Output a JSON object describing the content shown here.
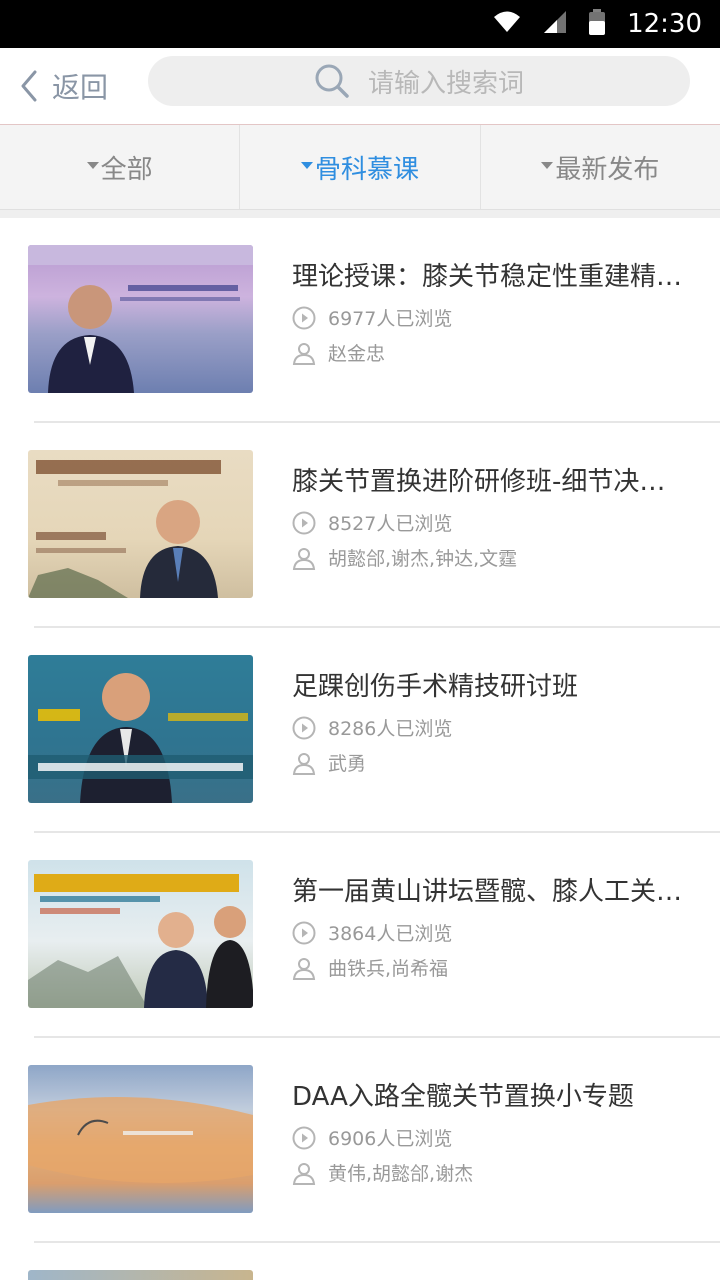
{
  "status_bar": {
    "time": "12:30"
  },
  "header": {
    "back_label": "返回",
    "search_placeholder": "请输入搜索词"
  },
  "tabs": [
    {
      "label": "全部",
      "active": false
    },
    {
      "label": "骨科慕课",
      "active": true
    },
    {
      "label": "最新发布",
      "active": false
    }
  ],
  "colors": {
    "accent": "#2f8ee0",
    "text": "#333333",
    "muted": "#999999"
  },
  "courses": [
    {
      "title": "理论授课：膝关节稳定性重建精…",
      "views": "6977人已浏览",
      "author": "赵金忠"
    },
    {
      "title": "膝关节置换进阶研修班-细节决…",
      "views": "8527人已浏览",
      "author": "胡懿郃,谢杰,钟达,文霆"
    },
    {
      "title": "足踝创伤手术精技研讨班",
      "views": "8286人已浏览",
      "author": "武勇"
    },
    {
      "title": "第一届黄山讲坛暨髋、膝人工关…",
      "views": "3864人已浏览",
      "author": "曲铁兵,尚希福"
    },
    {
      "title": "DAA入路全髋关节置换小专题",
      "views": "6906人已浏览",
      "author": "黄伟,胡懿郃,谢杰"
    }
  ]
}
